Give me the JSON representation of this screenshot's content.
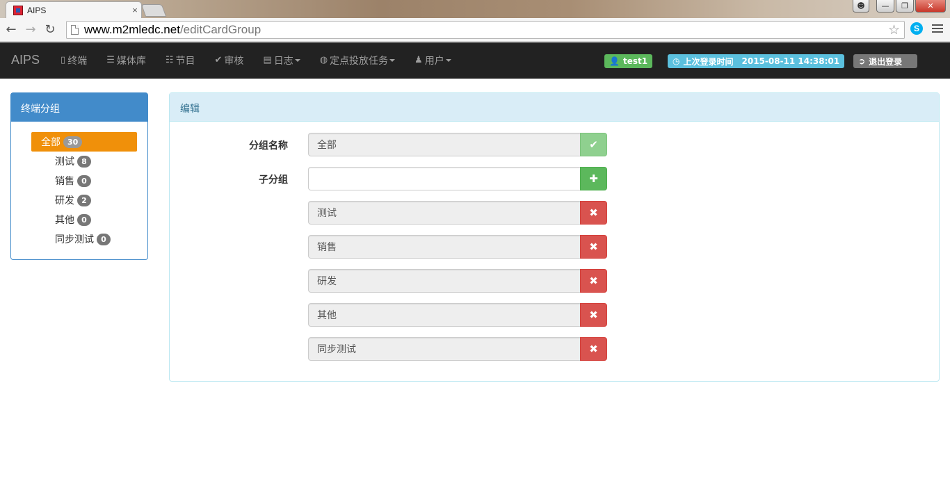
{
  "browser": {
    "tab_title": "AIPS",
    "tab_close": "×",
    "url_host": "www.m2mledc.net",
    "url_path": "/editCardGroup",
    "back_icon": "back-arrow-icon",
    "forward_icon": "forward-arrow-icon",
    "reload_icon": "reload-icon",
    "star_icon": "star-icon",
    "skype_label": "S"
  },
  "navbar": {
    "brand": "AIPS",
    "items": [
      {
        "label": "终端",
        "icon": "phone-icon",
        "dropdown": false
      },
      {
        "label": "媒体库",
        "icon": "list-icon",
        "dropdown": false
      },
      {
        "label": "节目",
        "icon": "list-alt-icon",
        "dropdown": false
      },
      {
        "label": "审核",
        "icon": "check-circle-icon",
        "dropdown": false
      },
      {
        "label": "日志",
        "icon": "file-icon",
        "dropdown": true
      },
      {
        "label": "定点投放任务",
        "icon": "globe-icon",
        "dropdown": true
      },
      {
        "label": "用户",
        "icon": "user-icon",
        "dropdown": true
      }
    ],
    "user_label": "test1",
    "last_login_label": "上次登录时间",
    "last_login_time": "2015-08-11 14:38:01",
    "logout_label": "退出登录"
  },
  "sidebar": {
    "title": "终端分组",
    "root": {
      "label": "全部",
      "count": "30"
    },
    "groups": [
      {
        "label": "测试",
        "count": "8"
      },
      {
        "label": "销售",
        "count": "0"
      },
      {
        "label": "研发",
        "count": "2"
      },
      {
        "label": "其他",
        "count": "0"
      },
      {
        "label": "同步测试",
        "count": "0"
      }
    ]
  },
  "edit": {
    "title": "编辑",
    "group_name_label": "分组名称",
    "group_name_value": "全部",
    "subgroup_label": "子分组",
    "subgroup_placeholder": "",
    "subgroups": [
      "测试",
      "销售",
      "研发",
      "其他",
      "同步测试"
    ]
  },
  "colors": {
    "navbar_bg": "#222222",
    "active_group": "#f0900a",
    "panel_primary": "#428bca",
    "success": "#5cb85c",
    "danger": "#d9534f",
    "info": "#5bc0de"
  }
}
